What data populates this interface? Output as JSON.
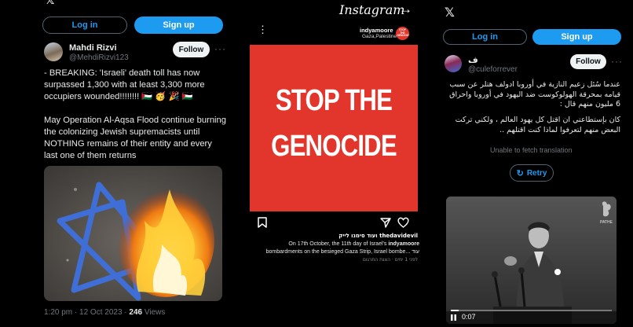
{
  "panel1": {
    "login_label": "Log in",
    "signup_label": "Sign up",
    "user_name": "Mahdi Rizvi",
    "user_handle": "@MehdiRizvi123",
    "follow_label": "Follow",
    "tweet_line1": "- BREAKING: 'Israeli' death toll has now surpassed 1,300 with at least 3,300 more occupiers wounded!!!!!!!! 🇵🇸 🥳 🎉 🇵🇸",
    "tweet_line2": "May Operation Al-Aqsa Flood continue burning the colonizing Jewish supremacists until NOTHING remains of their entity and every last one of them returns",
    "timestamp": "1:20 pm · 12 Oct 2023 · ",
    "views_count": "246",
    "views_label": " Views"
  },
  "panel2": {
    "app_title": "Instagram",
    "account_name": "indyamoore",
    "account_location": "Gaza,Palestine",
    "stop_badge": "STOP THE GENOCIDE",
    "poster_line1": "STOP THE",
    "poster_line2": "GENOCIDE",
    "liker_line": "thedavidevil ועוד סימנו לייק",
    "caption_line1": "On 17th October, the 11th day of Israel's ",
    "caption_user": "indyamoore",
    "caption_line2": "bombardments on the besieged Gaza Strip, Israel bombe... עוד",
    "time_line": "לפני 1 ימים · הצגת התרגום"
  },
  "panel3": {
    "login_label": "Log in",
    "signup_label": "Sign up",
    "user_name": "ف",
    "user_handle": "@culeforrever",
    "follow_label": "Follow",
    "tweet_para1": "عندما سُئل زعيم النازية في أوروبا ادولف هتلر عن سبب قيامه بمحرقة الهولوكوست ضد اليهود في أوروبا واحراق 6 مليون منهم قال :",
    "tweet_para2": "كان بإستطاعتي ان اقتل كل يهود العالم ، ولكني تركت البعض منهم لتعرفوا لماذا كنت اقتلهم ..",
    "translation_status": "Unable to fetch translation",
    "retry_label": "Retry",
    "video_time": "0:07",
    "video_watermark": "PATHE"
  },
  "colors": {
    "accent_blue": "#1d9bf0",
    "poster_red": "#e2352b",
    "background": "#000000"
  }
}
